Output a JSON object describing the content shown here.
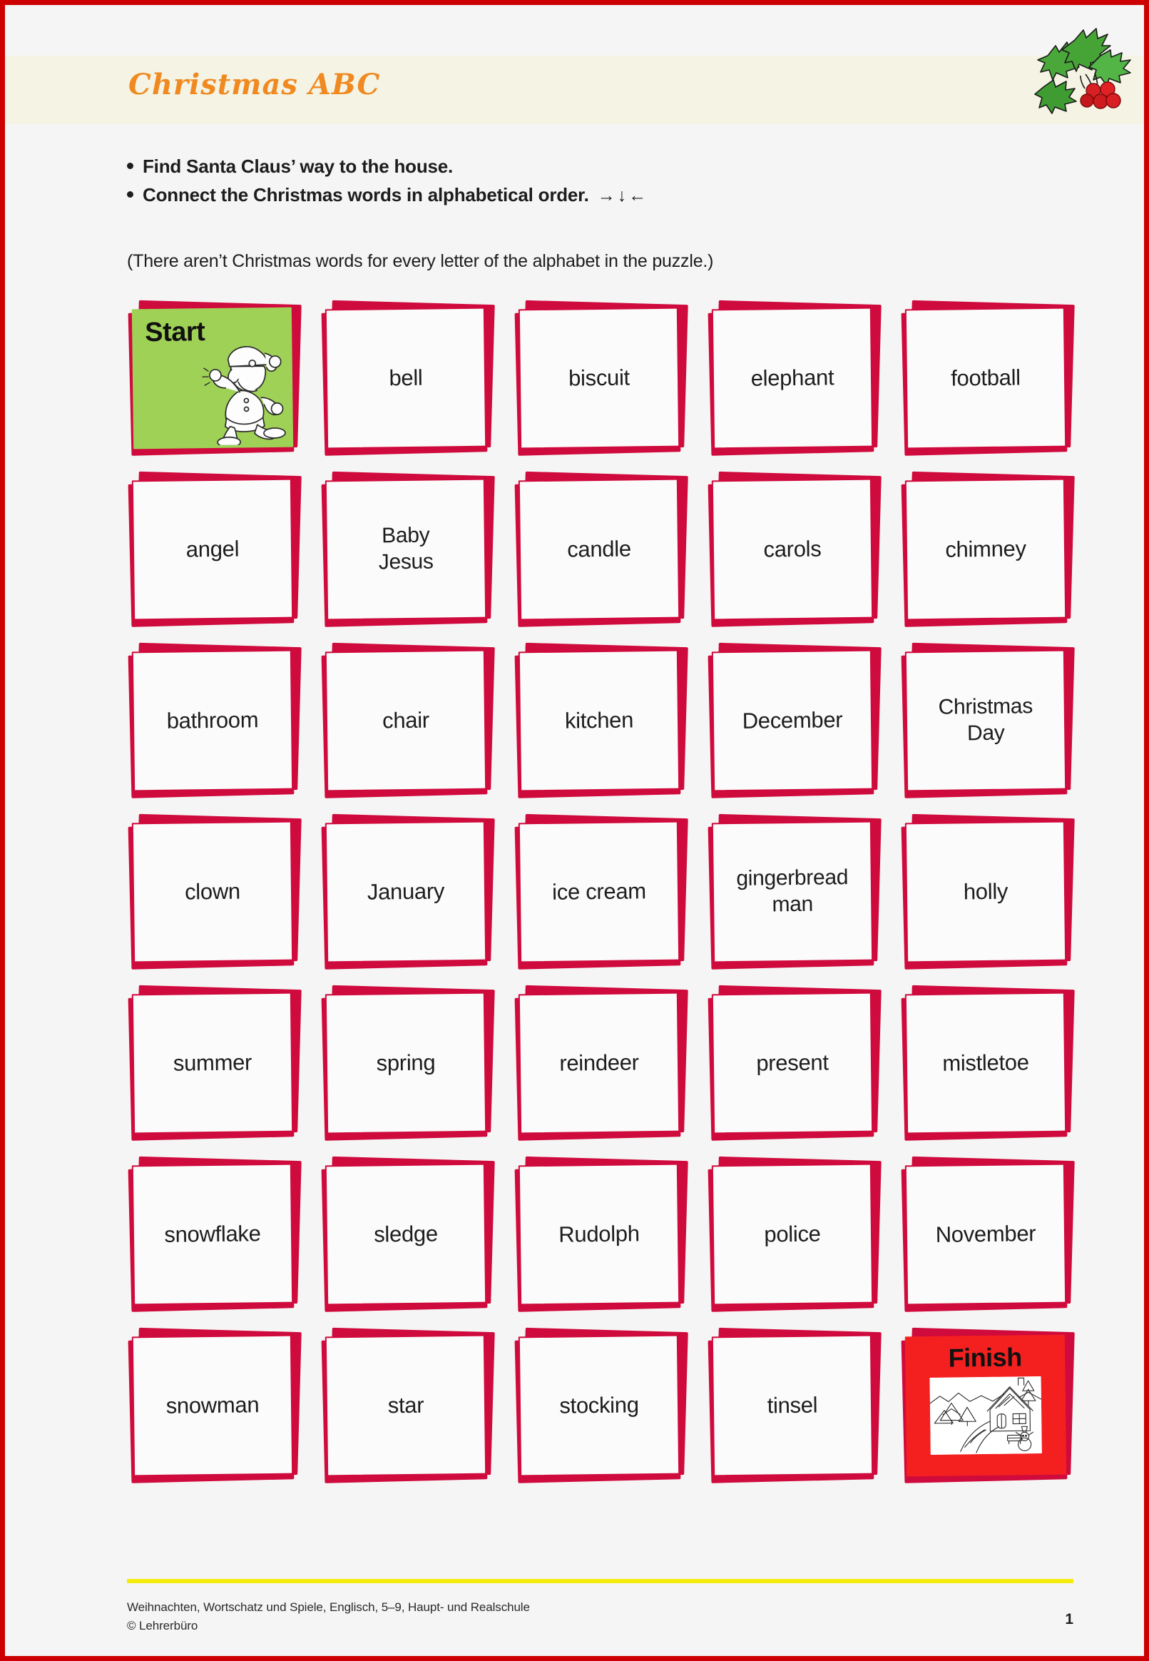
{
  "document": {
    "title": "Christmas ABC",
    "page_number": "1"
  },
  "instructions": {
    "line1": "Find Santa Claus’ way to the house.",
    "line2": "Connect the Christmas words in alphabetical order.",
    "arrows": "→↓←",
    "note": "(There aren’t Christmas words for every letter of the alphabet in the puzzle.)"
  },
  "decorations": {
    "holly": "holly-icon",
    "santa": "santa-running-icon",
    "house": "winter-house-scene-icon"
  },
  "grid": {
    "columns": 5,
    "rows": 7,
    "cards": [
      {
        "type": "start",
        "label": "Start",
        "lines": [
          "Start"
        ]
      },
      {
        "type": "word",
        "label": "bell",
        "lines": [
          "bell"
        ]
      },
      {
        "type": "word",
        "label": "biscuit",
        "lines": [
          "biscuit"
        ]
      },
      {
        "type": "word",
        "label": "elephant",
        "lines": [
          "elephant"
        ]
      },
      {
        "type": "word",
        "label": "football",
        "lines": [
          "football"
        ]
      },
      {
        "type": "word",
        "label": "angel",
        "lines": [
          "angel"
        ]
      },
      {
        "type": "word",
        "label": "Baby Jesus",
        "lines": [
          "Baby",
          "Jesus"
        ]
      },
      {
        "type": "word",
        "label": "candle",
        "lines": [
          "candle"
        ]
      },
      {
        "type": "word",
        "label": "carols",
        "lines": [
          "carols"
        ]
      },
      {
        "type": "word",
        "label": "chimney",
        "lines": [
          "chimney"
        ]
      },
      {
        "type": "word",
        "label": "bathroom",
        "lines": [
          "bathroom"
        ]
      },
      {
        "type": "word",
        "label": "chair",
        "lines": [
          "chair"
        ]
      },
      {
        "type": "word",
        "label": "kitchen",
        "lines": [
          "kitchen"
        ]
      },
      {
        "type": "word",
        "label": "December",
        "lines": [
          "December"
        ]
      },
      {
        "type": "word",
        "label": "Christmas Day",
        "lines": [
          "Christmas",
          "Day"
        ]
      },
      {
        "type": "word",
        "label": "clown",
        "lines": [
          "clown"
        ]
      },
      {
        "type": "word",
        "label": "January",
        "lines": [
          "January"
        ]
      },
      {
        "type": "word",
        "label": "ice cream",
        "lines": [
          "ice cream"
        ]
      },
      {
        "type": "word",
        "label": "gingerbread man",
        "lines": [
          "gingerbread",
          "man"
        ]
      },
      {
        "type": "word",
        "label": "holly",
        "lines": [
          "holly"
        ]
      },
      {
        "type": "word",
        "label": "summer",
        "lines": [
          "summer"
        ]
      },
      {
        "type": "word",
        "label": "spring",
        "lines": [
          "spring"
        ]
      },
      {
        "type": "word",
        "label": "reindeer",
        "lines": [
          "reindeer"
        ]
      },
      {
        "type": "word",
        "label": "present",
        "lines": [
          "present"
        ]
      },
      {
        "type": "word",
        "label": "mistletoe",
        "lines": [
          "mistletoe"
        ]
      },
      {
        "type": "word",
        "label": "snowflake",
        "lines": [
          "snowflake"
        ]
      },
      {
        "type": "word",
        "label": "sledge",
        "lines": [
          "sledge"
        ]
      },
      {
        "type": "word",
        "label": "Rudolph",
        "lines": [
          "Rudolph"
        ]
      },
      {
        "type": "word",
        "label": "police",
        "lines": [
          "police"
        ]
      },
      {
        "type": "word",
        "label": "November",
        "lines": [
          "November"
        ]
      },
      {
        "type": "word",
        "label": "snowman",
        "lines": [
          "snowman"
        ]
      },
      {
        "type": "word",
        "label": "star",
        "lines": [
          "star"
        ]
      },
      {
        "type": "word",
        "label": "stocking",
        "lines": [
          "stocking"
        ]
      },
      {
        "type": "word",
        "label": "tinsel",
        "lines": [
          "tinsel"
        ]
      },
      {
        "type": "finish",
        "label": "Finish",
        "lines": [
          "Finish"
        ]
      }
    ]
  },
  "footer": {
    "line1": "Weihnachten, Wortschatz und Spiele, Englisch, 5–9, Haupt- und Realschule",
    "line2": "© Lehrerbüro"
  },
  "colors": {
    "page_border": "#cc0000",
    "header_band": "#f4f3e4",
    "title": "#f08a20",
    "card_red": "#cf0a3c",
    "start_green": "#9fd157",
    "finish_red": "#f42020",
    "footer_rule": "#f5ec0e",
    "page_background": "#f5f5f5"
  }
}
